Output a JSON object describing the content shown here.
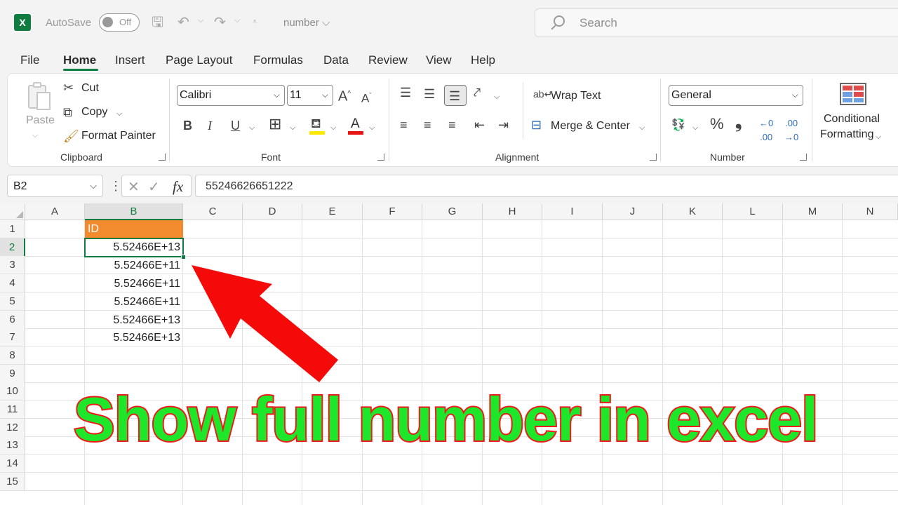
{
  "titlebar": {
    "app_icon": "excel-logo",
    "app_icon_letter": "X",
    "autosave_label": "AutoSave",
    "autosave_state": "Off",
    "document_name": "number ⌵",
    "search_placeholder": "Search"
  },
  "menu": {
    "tabs": [
      "File",
      "Home",
      "Insert",
      "Page Layout",
      "Formulas",
      "Data",
      "Review",
      "View",
      "Help"
    ],
    "active": "Home"
  },
  "ribbon": {
    "clipboard": {
      "label": "Clipboard",
      "paste": "Paste",
      "cut": "Cut",
      "copy": "Copy",
      "format_painter": "Format Painter"
    },
    "font": {
      "label": "Font",
      "font_name": "Calibri",
      "font_size": "11",
      "bold": "B",
      "italic": "I",
      "underline": "U"
    },
    "alignment": {
      "label": "Alignment",
      "wrap_text": "Wrap Text",
      "merge_center": "Merge & Center"
    },
    "number": {
      "label": "Number",
      "format": "General",
      "percent": "%",
      "comma": "❟"
    },
    "styles": {
      "conditional_formatting_line1": "Conditional",
      "conditional_formatting_line2": "Formatting"
    }
  },
  "formula_bar": {
    "name_box": "B2",
    "fx": "fx",
    "value": "55246626651222"
  },
  "sheet": {
    "columns": [
      "A",
      "B",
      "C",
      "D",
      "E",
      "F",
      "G",
      "H",
      "I",
      "J",
      "K",
      "L",
      "M",
      "N"
    ],
    "rows": [
      "1",
      "2",
      "3",
      "4",
      "5",
      "6",
      "7",
      "8",
      "9",
      "10",
      "11",
      "12",
      "13",
      "14",
      "15"
    ],
    "selected_cell": "B2",
    "header_fill": "#f28a2e",
    "cells": {
      "B1": "ID",
      "B2": "5.52466E+13",
      "B3": "5.52466E+11",
      "B4": "5.52466E+11",
      "B5": "5.52466E+11",
      "B6": "5.52466E+13",
      "B7": "5.52466E+13"
    }
  },
  "overlay": {
    "caption": "Show full number in excel",
    "caption_fill": "#1ee62a",
    "caption_outline": "#ef1b1b",
    "arrow_color": "#f50a0a"
  }
}
